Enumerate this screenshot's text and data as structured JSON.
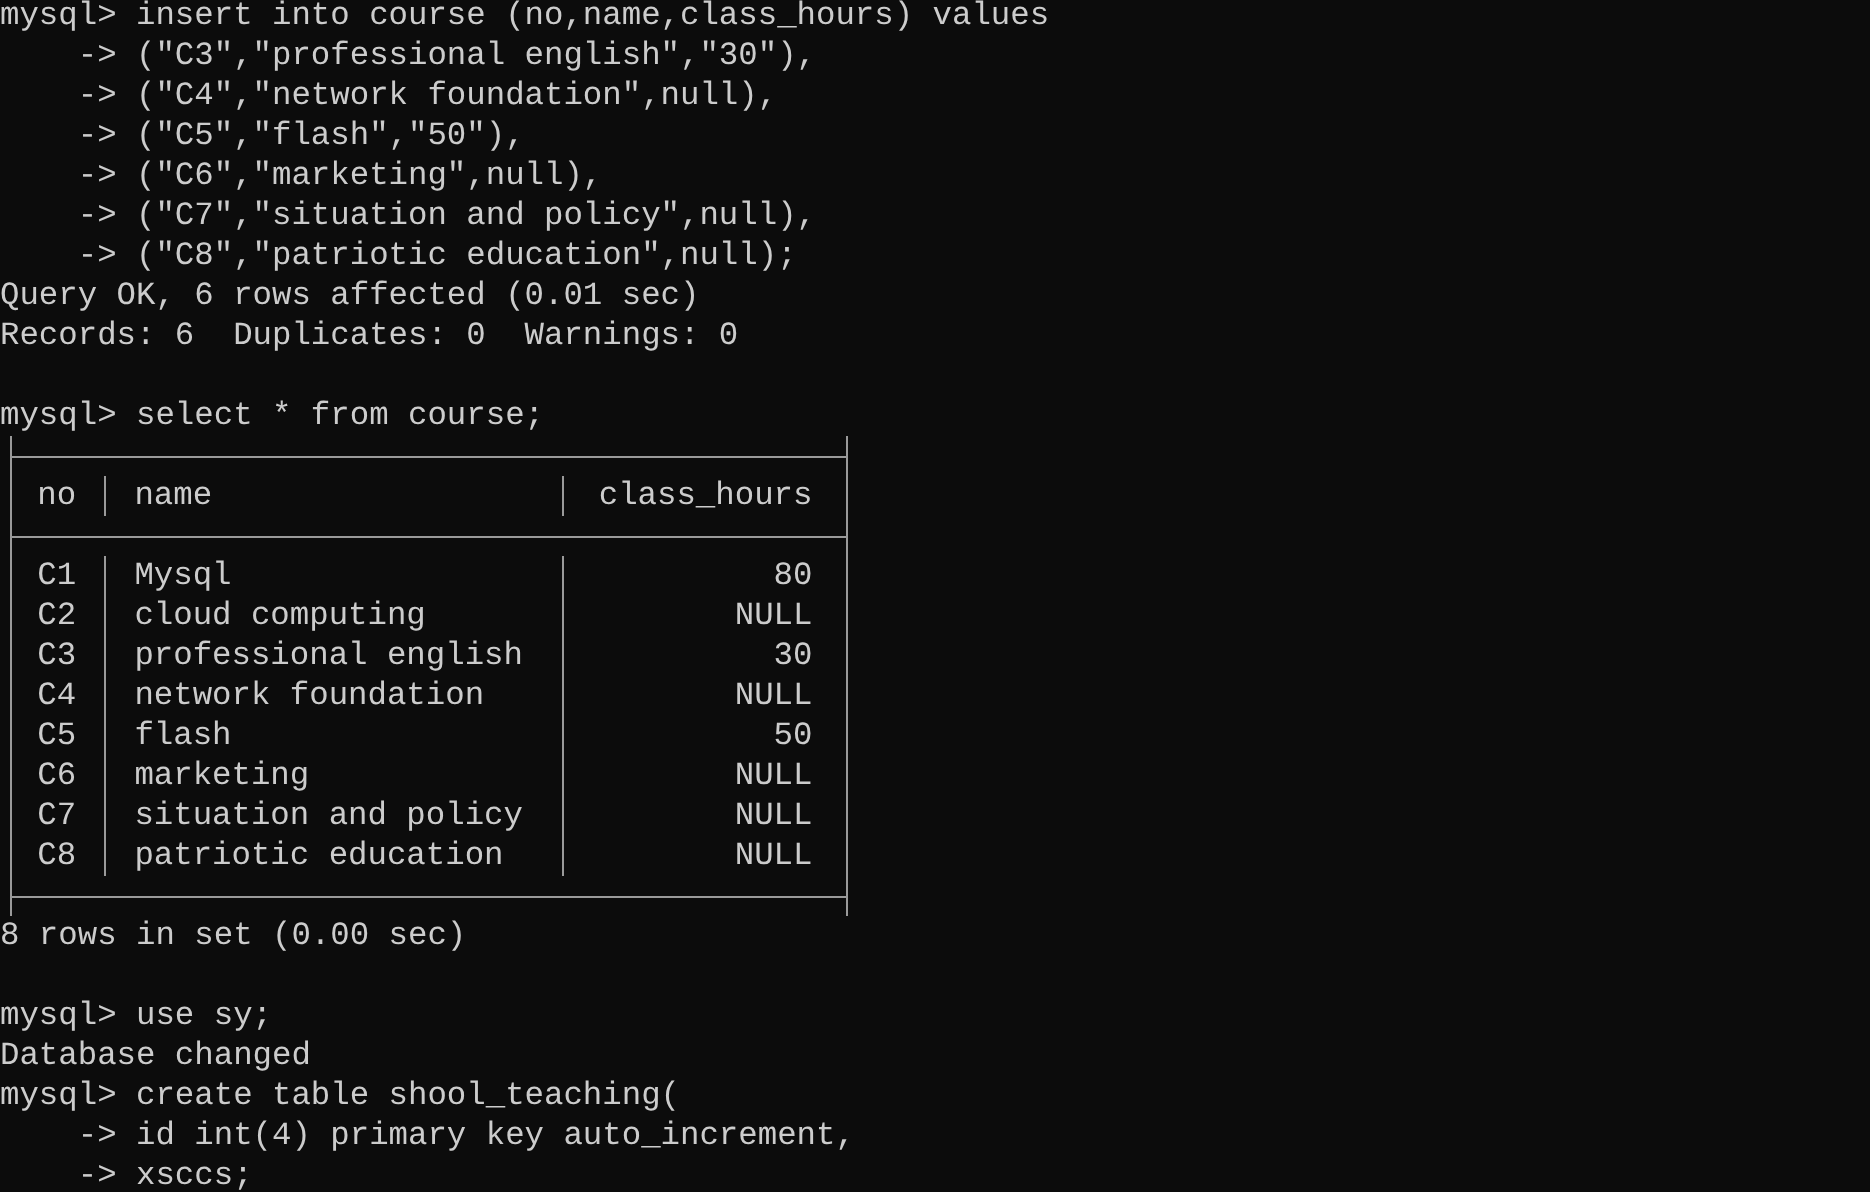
{
  "terminal": {
    "blocks": [
      [
        {
          "kind": "line",
          "text": "mysql> insert into course (no,name,class_hours) values"
        },
        {
          "kind": "line",
          "text": "    -> (\"C3\",\"professional english\",\"30\"),"
        },
        {
          "kind": "line",
          "text": "    -> (\"C4\",\"network foundation\",null),"
        },
        {
          "kind": "line",
          "text": "    -> (\"C5\",\"flash\",\"50\"),"
        },
        {
          "kind": "line",
          "text": "    -> (\"C6\",\"marketing\",null),"
        },
        {
          "kind": "line",
          "text": "    -> (\"C7\",\"situation and policy\",null),"
        },
        {
          "kind": "line",
          "text": "    -> (\"C8\",\"patriotic education\",null);"
        },
        {
          "kind": "line",
          "text": "Query OK, 6 rows affected (0.01 sec)"
        },
        {
          "kind": "line",
          "text": "Records: 6  Duplicates: 0  Warnings: 0"
        }
      ],
      [
        {
          "kind": "line",
          "text": "mysql> select * from course;"
        },
        {
          "kind": "table",
          "columns": [
            {
              "label": "no",
              "kind": "text"
            },
            {
              "label": "name",
              "kind": "text"
            },
            {
              "label": "class_hours",
              "kind": "number"
            }
          ],
          "rows": [
            [
              "C1",
              "Mysql",
              "80"
            ],
            [
              "C2",
              "cloud computing",
              "NULL"
            ],
            [
              "C3",
              "professional english",
              "30"
            ],
            [
              "C4",
              "network foundation",
              "NULL"
            ],
            [
              "C5",
              "flash",
              "50"
            ],
            [
              "C6",
              "marketing",
              "NULL"
            ],
            [
              "C7",
              "situation and policy",
              "NULL"
            ],
            [
              "C8",
              "patriotic education",
              "NULL"
            ]
          ]
        },
        {
          "kind": "line",
          "text": "8 rows in set (0.00 sec)"
        }
      ],
      [
        {
          "kind": "line",
          "text": "mysql> use sy;"
        },
        {
          "kind": "line",
          "text": "Database changed"
        },
        {
          "kind": "line",
          "text": "mysql> create table shool_teaching("
        },
        {
          "kind": "line",
          "text": "    -> id int(4) primary key auto_increment,"
        },
        {
          "kind": "line",
          "text": "    -> xsccs;"
        }
      ]
    ]
  }
}
